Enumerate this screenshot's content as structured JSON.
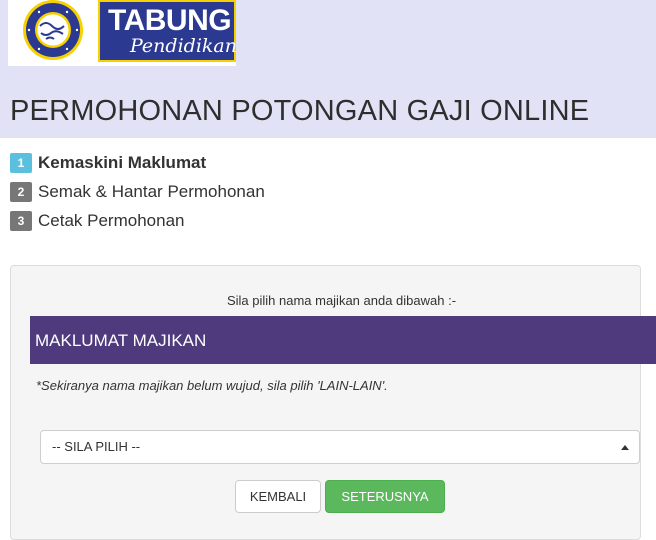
{
  "logo": {
    "title": "TABUNG",
    "subtitle": "Pendidikan",
    "seal_text": "PERBADANAN TABUNG PENDIDIKAN TINGGI NASIONAL",
    "colors": {
      "box": "#2b3990",
      "border": "#f7d000",
      "seal": "#2b3990"
    }
  },
  "page_title": "PERMOHONAN POTONGAN GAJI ONLINE",
  "steps": [
    {
      "number": "1",
      "label": "Kemaskini Maklumat",
      "active": true,
      "color": "#5bc0de"
    },
    {
      "number": "2",
      "label": "Semak & Hantar Permohonan",
      "active": false,
      "color": "#777777"
    },
    {
      "number": "3",
      "label": "Cetak Permohonan",
      "active": false,
      "color": "#777777"
    }
  ],
  "form": {
    "instruction": "Sila pilih nama majikan anda dibawah :-",
    "section_title": "MAKLUMAT MAJIKAN",
    "note": "*Sekiranya nama majikan belum wujud, sila pilih 'LAIN-LAIN'.",
    "employer_select": {
      "selected": "-- SILA PILIH --"
    },
    "back_label": "KEMBALI",
    "next_label": "SETERUSNYA"
  },
  "colors": {
    "header_bg": "#e2e2f7",
    "section_bar": "#4e3a7d",
    "primary_button": "#5cb85c"
  }
}
